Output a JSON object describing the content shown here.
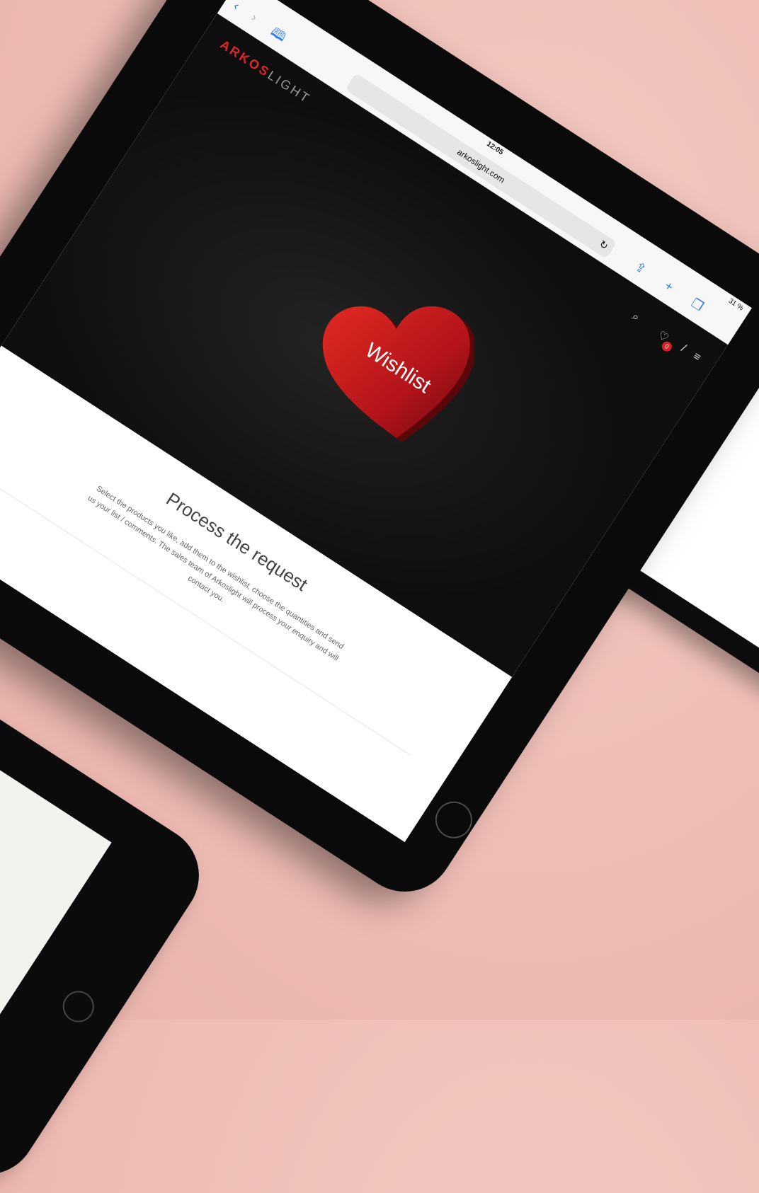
{
  "device": {
    "model": "iPad",
    "time": "12:05",
    "battery": "31 %"
  },
  "browser": {
    "url": "arkoslight.com"
  },
  "site": {
    "logo_red": "ARKOS",
    "logo_grey": "LIGHT",
    "wishlist_count": "0",
    "hero_label": "Wishlist"
  },
  "content": {
    "heading": "Process the request",
    "body": "Select the products you like, add them to the wishlist, choose the quantities and send us your list / comments. The sales team of Arkoslight will process your enquiry and will contact you."
  },
  "colors": {
    "brand_red": "#e0262b",
    "background_pink": "#eebdb5"
  }
}
